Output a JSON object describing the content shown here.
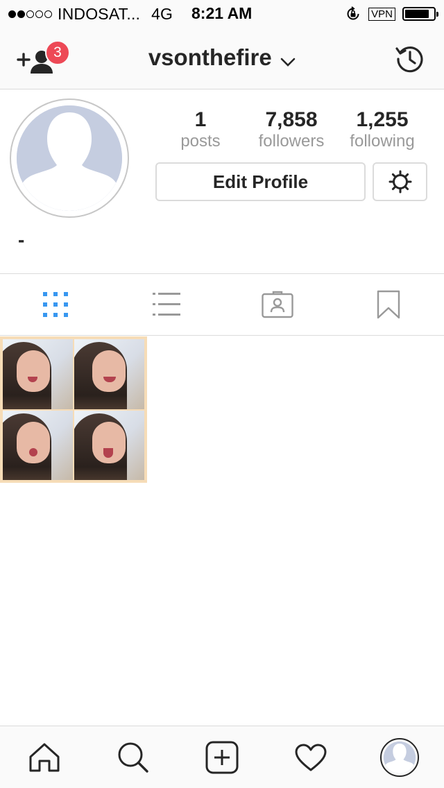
{
  "status_bar": {
    "carrier": "INDOSAT...",
    "network": "4G",
    "time": "8:21 AM",
    "vpn": "VPN",
    "signal_bars_filled": 2,
    "signal_bars_total": 5,
    "battery_level": 0.85
  },
  "header": {
    "username": "vsonthefire",
    "discover_badge_count": "3"
  },
  "profile": {
    "bio": "-",
    "edit_profile_label": "Edit Profile",
    "stats": [
      {
        "value": "1",
        "label": "posts"
      },
      {
        "value": "7,858",
        "label": "followers"
      },
      {
        "value": "1,255",
        "label": "following"
      }
    ]
  },
  "tabs": [
    {
      "name": "grid",
      "icon": "grid-icon",
      "active": true
    },
    {
      "name": "list",
      "icon": "list-icon",
      "active": false
    },
    {
      "name": "tagged",
      "icon": "tagged-person-icon",
      "active": false
    },
    {
      "name": "saved",
      "icon": "bookmark-icon",
      "active": false
    }
  ],
  "bottom_nav": [
    {
      "name": "home",
      "icon": "home-icon"
    },
    {
      "name": "search",
      "icon": "search-icon"
    },
    {
      "name": "new-post",
      "icon": "add-post-icon"
    },
    {
      "name": "activity",
      "icon": "heart-icon"
    },
    {
      "name": "profile",
      "icon": "avatar"
    }
  ],
  "colors": {
    "accent_blue": "#3897f0",
    "badge_red": "#ed4956",
    "text": "#262626",
    "muted": "#999999",
    "border": "#dbdbdb",
    "avatar_placeholder": "#c5cde0"
  }
}
